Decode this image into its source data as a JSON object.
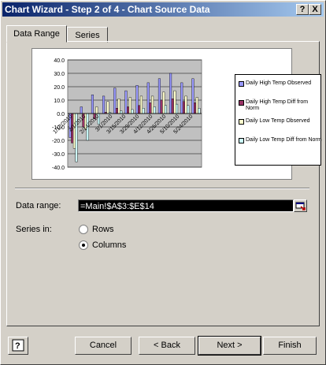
{
  "window": {
    "title": "Chart Wizard - Step 2 of 4 - Chart Source Data",
    "help_btn": "?",
    "close_btn": "X"
  },
  "tabs": [
    {
      "label": "Data Range",
      "active": true
    },
    {
      "label": "Series",
      "active": false
    }
  ],
  "chart_data": {
    "type": "bar",
    "ylim": [
      -40,
      40
    ],
    "y_ticks": [
      "40.0",
      "30.0",
      "20.0",
      "10.0",
      "0.0",
      "-10.0",
      "-20.0",
      "-30.0",
      "-40.0"
    ],
    "categories": [
      "1/12/2010",
      "2/1/2010",
      "2/14/2010",
      "3/1/2010",
      "3/15/2010",
      "3/29/2010",
      "4/12/2010",
      "4/26/2010",
      "5/10/2010",
      "5/24/2010",
      "6/7/2010",
      "6/21/2010"
    ],
    "x_tick_labels": [
      "1/12/2010",
      "2/1/2010",
      "2/14/2010",
      "3/1/2010",
      "3/15/2010",
      "3/29/2010",
      "4/12/2010",
      "4/26/2010",
      "5/10/2010",
      "5/24/2010"
    ],
    "series": [
      {
        "name": "Daily High Temp Observed",
        "color": "#9999ff",
        "values": [
          -18,
          5,
          14,
          13,
          19,
          17,
          21,
          23,
          26,
          30,
          23,
          26
        ]
      },
      {
        "name": "Daily High Temp Diff from Norm",
        "color": "#993366",
        "values": [
          -22,
          -10,
          -4,
          1,
          4,
          5,
          6,
          8,
          10,
          11,
          9,
          8
        ]
      },
      {
        "name": "Daily Low Temp Observed",
        "color": "#ffffcc",
        "values": [
          -26,
          -12,
          5,
          9,
          11,
          12,
          13,
          13,
          16,
          17,
          13,
          12
        ]
      },
      {
        "name": "Daily Low Temp Diff from Norm",
        "color": "#ccffff",
        "values": [
          -36,
          -20,
          -8,
          1,
          2,
          3,
          4,
          5,
          6,
          7,
          6,
          4
        ]
      }
    ],
    "grid": true,
    "legend": "right"
  },
  "data_range": {
    "label": "Data range:",
    "value": "=Main!$A$3:$E$14"
  },
  "series_in": {
    "label": "Series in:",
    "options": [
      {
        "label": "Rows",
        "selected": false
      },
      {
        "label": "Columns",
        "selected": true
      }
    ]
  },
  "buttons": {
    "cancel": "Cancel",
    "back": "< Back",
    "next": "Next >",
    "finish": "Finish"
  }
}
